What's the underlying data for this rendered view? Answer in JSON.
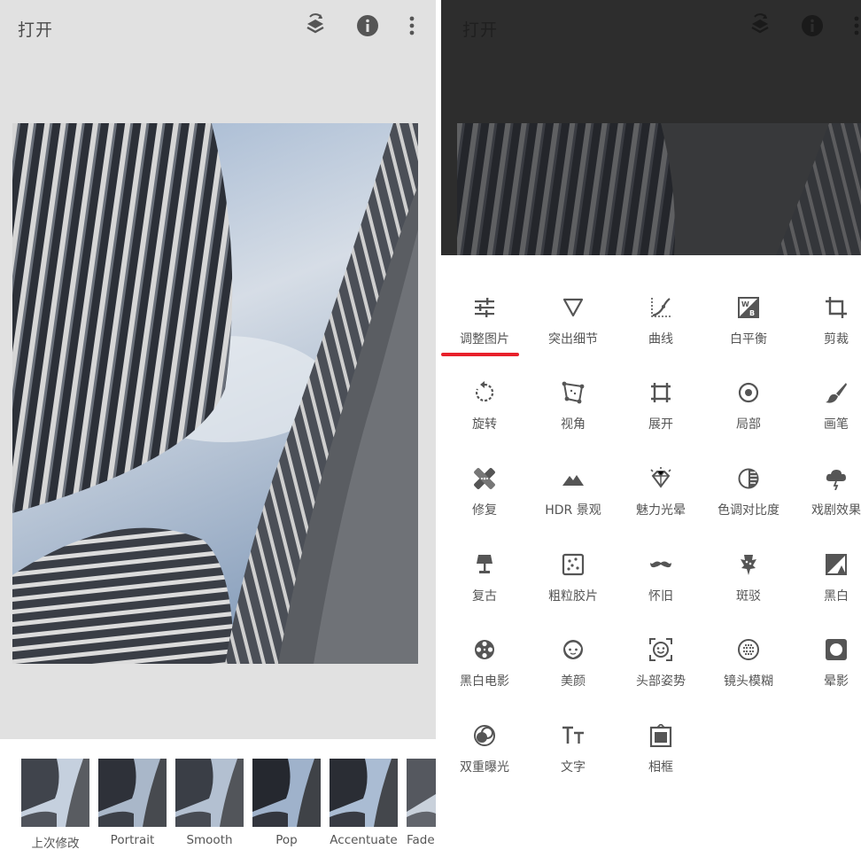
{
  "left": {
    "title": "打开",
    "toolbar_icons": [
      "layers-swap-icon",
      "info-icon",
      "more-vert-icon"
    ],
    "looks": [
      {
        "label": "上次修改"
      },
      {
        "label": "Portrait"
      },
      {
        "label": "Smooth"
      },
      {
        "label": "Pop"
      },
      {
        "label": "Accentuate"
      },
      {
        "label": "Fade"
      }
    ]
  },
  "right": {
    "title": "打开",
    "tools": [
      {
        "label": "调整图片",
        "icon": "tune-icon"
      },
      {
        "label": "突出细节",
        "icon": "details-triangle-icon"
      },
      {
        "label": "曲线",
        "icon": "curves-icon"
      },
      {
        "label": "白平衡",
        "icon": "white-balance-icon"
      },
      {
        "label": "剪裁",
        "icon": "crop-icon"
      },
      {
        "label": "旋转",
        "icon": "rotate-icon"
      },
      {
        "label": "视角",
        "icon": "perspective-icon"
      },
      {
        "label": "展开",
        "icon": "expand-icon"
      },
      {
        "label": "局部",
        "icon": "selective-icon"
      },
      {
        "label": "画笔",
        "icon": "brush-icon"
      },
      {
        "label": "修复",
        "icon": "healing-icon"
      },
      {
        "label": "HDR 景观",
        "icon": "hdr-mountain-icon"
      },
      {
        "label": "魅力光晕",
        "icon": "glamour-glow-icon"
      },
      {
        "label": "色调对比度",
        "icon": "tonal-contrast-icon"
      },
      {
        "label": "戏剧效果",
        "icon": "drama-cloud-icon"
      },
      {
        "label": "复古",
        "icon": "vintage-lamp-icon"
      },
      {
        "label": "粗粒胶片",
        "icon": "grainy-film-icon"
      },
      {
        "label": "怀旧",
        "icon": "retrolux-mustache-icon"
      },
      {
        "label": "斑驳",
        "icon": "grunge-icon"
      },
      {
        "label": "黑白",
        "icon": "black-white-icon"
      },
      {
        "label": "黑白电影",
        "icon": "noir-film-reel-icon"
      },
      {
        "label": "美颜",
        "icon": "face-icon"
      },
      {
        "label": "头部姿势",
        "icon": "head-pose-icon"
      },
      {
        "label": "镜头模糊",
        "icon": "lens-blur-icon"
      },
      {
        "label": "晕影",
        "icon": "vignette-icon"
      },
      {
        "label": "双重曝光",
        "icon": "double-exposure-icon"
      },
      {
        "label": "文字",
        "icon": "text-icon"
      },
      {
        "label": "相框",
        "icon": "frame-icon"
      }
    ]
  },
  "colors": {
    "accent_underline": "#e8202a",
    "dark_overlay": "#2d2d2d",
    "panel_bg": "#e1e1e1"
  }
}
